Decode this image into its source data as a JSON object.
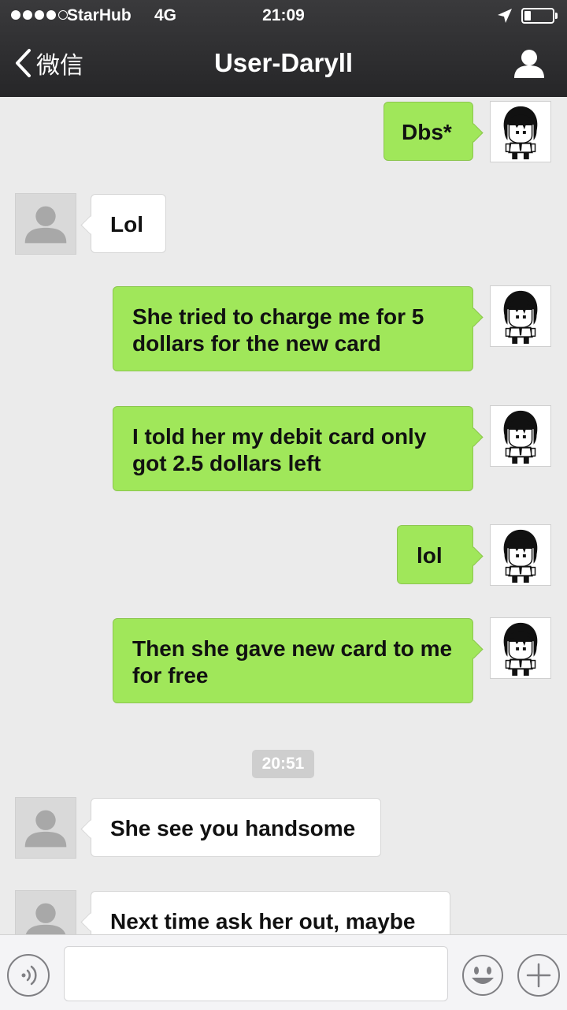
{
  "status_bar": {
    "carrier": "StarHub",
    "network": "4G",
    "time": "21:09",
    "signal_bars": 4,
    "signal_total": 5,
    "battery_level": 0.2
  },
  "nav": {
    "back_label": "微信",
    "title": "User-Daryll",
    "back_icon": "chevron-left-icon",
    "profile_icon": "person-icon"
  },
  "messages": [
    {
      "side": "out",
      "text": "Dbs*"
    },
    {
      "side": "in",
      "text": "Lol"
    },
    {
      "side": "out",
      "text": "She tried to charge me for 5 dollars for the new card"
    },
    {
      "side": "out",
      "text": "I told her my debit card only got 2.5 dollars left"
    },
    {
      "side": "out",
      "text": "lol"
    },
    {
      "side": "out",
      "text": "Then she gave new card to me for free"
    },
    {
      "side": "in",
      "text": "She see you handsome"
    },
    {
      "side": "in",
      "text": "Next time ask her out, maybe"
    }
  ],
  "timestamp": "20:51",
  "colors": {
    "outgoing_bubble": "#a0e75a",
    "incoming_bubble": "#ffffff",
    "header_bg": "#2c2c2e",
    "chat_bg": "#ebebeb"
  },
  "input_bar": {
    "voice_icon": "voice-icon",
    "emoji_icon": "emoji-icon",
    "plus_icon": "plus-icon"
  }
}
